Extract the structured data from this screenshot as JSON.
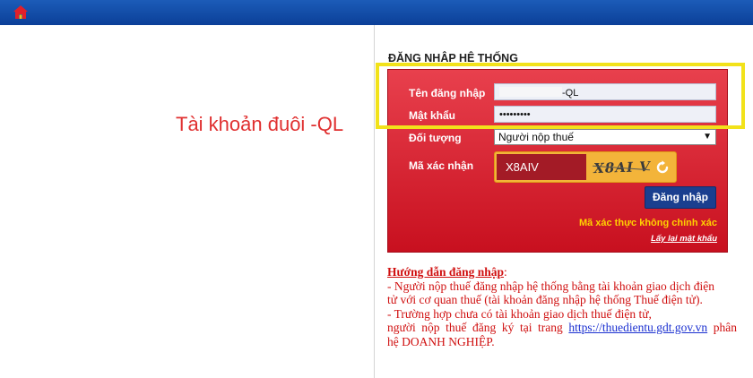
{
  "annotation": "Tài khoản đuôi -QL",
  "form": {
    "title": "ĐĂNG NHẬP HỆ THỐNG",
    "username_label": "Tên đăng nhập",
    "username_value": "-QL",
    "password_label": "Mật khẩu",
    "password_value": "•••••••••",
    "object_label": "Đối tượng",
    "object_value": "Người nộp thuế",
    "captcha_label": "Mã xác nhận",
    "captcha_input": "X8AIV",
    "captcha_image_text": "X8AI V",
    "login_button": "Đăng nhập",
    "error_message": "Mã xác thực không chính xác",
    "forgot_password": "Lấy lại mật khẩu"
  },
  "guide": {
    "title": "Hướng dẫn đăng nhập",
    "title_suffix": ":",
    "line1a": "- Người nộp thuế đăng nhập hệ thống bằng tài khoản giao dịch điện",
    "line1b": "tử với cơ quan thuế (tài khoản đăng nhập hệ thống Thuế điện tử).",
    "line2a": "- Trường hợp chưa có tài khoản giao dịch thuế điện tử,",
    "line2b_prefix": "người nộp thuế đăng ký tại trang",
    "link": "https://thuedientu.gdt.gov.vn",
    "line2b_suffix": "phân",
    "line2c": "hệ DOANH NGHIỆP."
  },
  "colors": {
    "topbar": "#0b3f98",
    "form_red": "#d42030",
    "highlight": "#f2e21a",
    "button_blue": "#1a3f8f",
    "error_yellow": "#ffd200"
  }
}
